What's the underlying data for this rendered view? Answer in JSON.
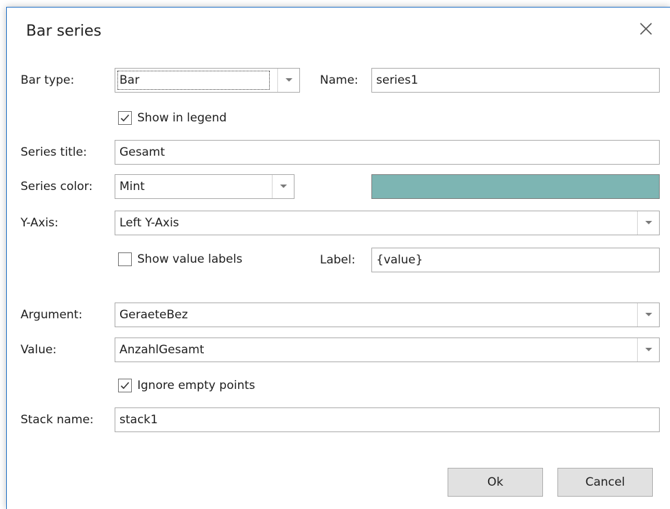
{
  "window": {
    "title": "Bar series"
  },
  "form": {
    "bar_type_label": "Bar type:",
    "bar_type_value": "Bar",
    "name_label": "Name:",
    "name_value": "series1",
    "show_in_legend_label": "Show in legend",
    "show_in_legend_checked": true,
    "series_title_label": "Series title:",
    "series_title_value": "Gesamt",
    "series_color_label": "Series color:",
    "series_color_value": "Mint",
    "series_color_hex": "#7db5b3",
    "y_axis_label": "Y-Axis:",
    "y_axis_value": "Left Y-Axis",
    "show_value_labels_label": "Show value labels",
    "show_value_labels_checked": false,
    "label_label": "Label:",
    "label_value": "{value}",
    "argument_label": "Argument:",
    "argument_value": "GeraeteBez",
    "value_label": "Value:",
    "value_value": "AnzahlGesamt",
    "ignore_empty_points_label": "Ignore empty points",
    "ignore_empty_points_checked": true,
    "stack_name_label": "Stack name:",
    "stack_name_value": "stack1"
  },
  "buttons": {
    "ok_label": "Ok",
    "cancel_label": "Cancel"
  },
  "icons": {
    "close": "close-icon",
    "dropdown": "chevron-down-icon",
    "check": "checkmark-icon"
  }
}
